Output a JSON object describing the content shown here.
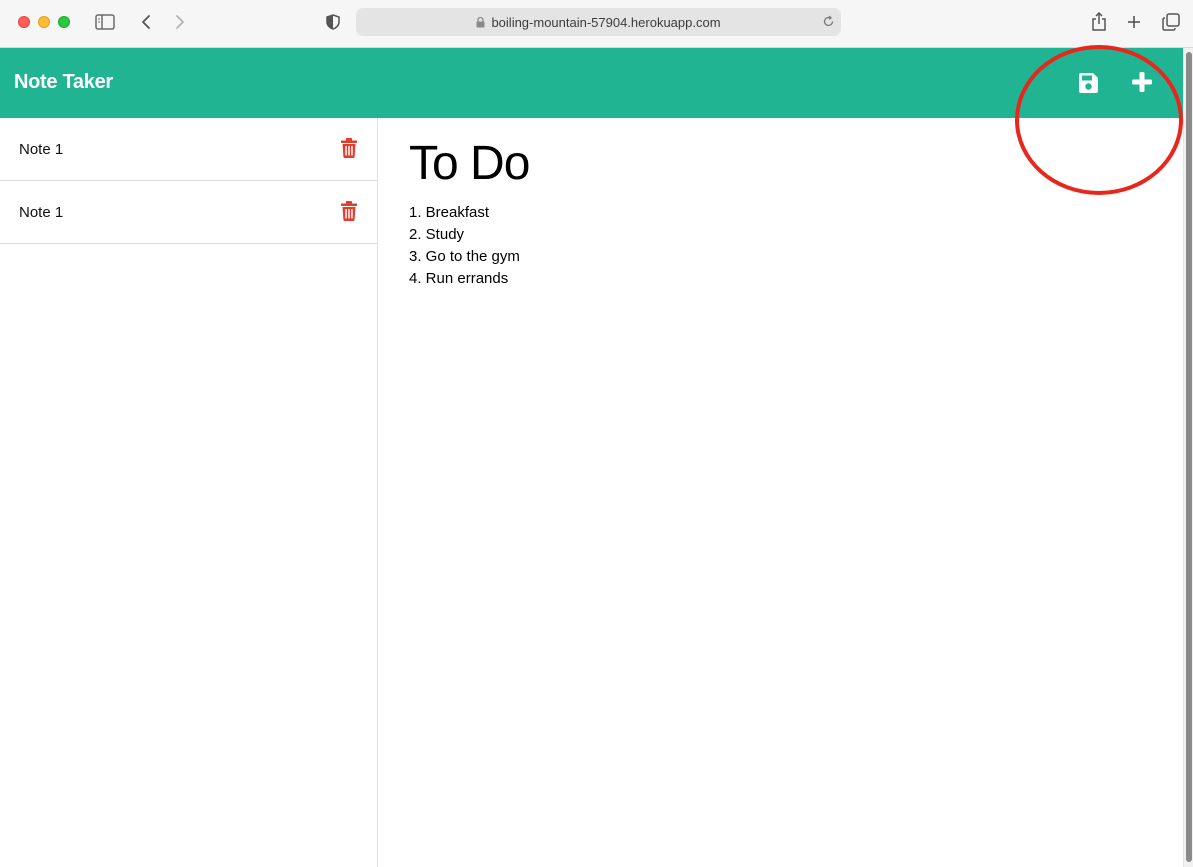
{
  "browser": {
    "url": "boiling-mountain-57904.herokuapp.com"
  },
  "app": {
    "title": "Note Taker",
    "accent_color": "#20b492",
    "delete_color": "#e33b2e"
  },
  "notes": [
    {
      "title": "Note 1"
    },
    {
      "title": "Note 1"
    }
  ],
  "active_note": {
    "title": "To Do",
    "text": "1. Breakfast\n2. Study\n3. Go to the gym\n4. Run errands"
  },
  "icons": {
    "save": "save-icon",
    "new": "plus-icon",
    "delete": "trash-icon"
  }
}
